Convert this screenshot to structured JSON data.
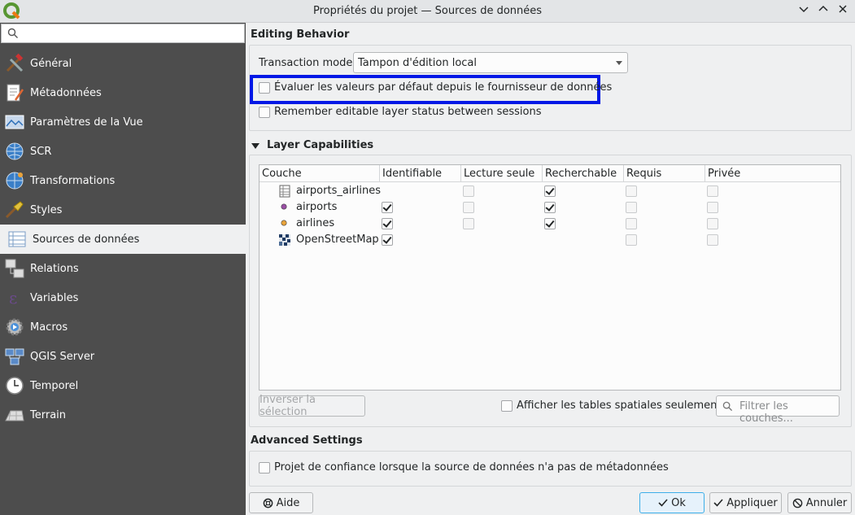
{
  "window": {
    "title": "Propriétés du projet — Sources de données"
  },
  "sidebar": {
    "search_placeholder": "",
    "items": [
      {
        "label": "Général",
        "icon": "tools-icon"
      },
      {
        "label": "Métadonnées",
        "icon": "document-edit-icon"
      },
      {
        "label": "Paramètres de la Vue",
        "icon": "map-view-icon"
      },
      {
        "label": "SCR",
        "icon": "globe-icon"
      },
      {
        "label": "Transformations",
        "icon": "globe-transform-icon"
      },
      {
        "label": "Styles",
        "icon": "paintbrush-icon"
      },
      {
        "label": "Sources de données",
        "icon": "table-list-icon"
      },
      {
        "label": "Relations",
        "icon": "relations-icon"
      },
      {
        "label": "Variables",
        "icon": "epsilon-icon"
      },
      {
        "label": "Macros",
        "icon": "gear-play-icon"
      },
      {
        "label": "QGIS Server",
        "icon": "server-icon"
      },
      {
        "label": "Temporel",
        "icon": "clock-icon"
      },
      {
        "label": "Terrain",
        "icon": "terrain-icon"
      }
    ],
    "active_index": 6
  },
  "editing": {
    "title": "Editing Behavior",
    "transaction_label": "Transaction mode",
    "transaction_value": "Tampon d'édition local",
    "evaluate_defaults_label": "Évaluer les valeurs par défaut depuis le fournisseur de données",
    "evaluate_defaults_checked": false,
    "remember_label": "Remember editable layer status between sessions",
    "remember_checked": false
  },
  "layers": {
    "title": "Layer Capabilities",
    "columns": [
      "Couche",
      "Identifiable",
      "Lecture seule",
      "Recherchable",
      "Requis",
      "Privée"
    ],
    "rows": [
      {
        "name": "airports_airlines",
        "icon": "table-icon",
        "identifiable": null,
        "readonly": false,
        "searchable": true,
        "required": false,
        "private": false
      },
      {
        "name": "airports",
        "icon": "purple-point-icon",
        "identifiable": true,
        "readonly": false,
        "searchable": true,
        "required": false,
        "private": false
      },
      {
        "name": "airlines",
        "icon": "orange-point-icon",
        "identifiable": true,
        "readonly": false,
        "searchable": true,
        "required": false,
        "private": false
      },
      {
        "name": "OpenStreetMap",
        "icon": "raster-tile-icon",
        "identifiable": true,
        "readonly": null,
        "searchable": null,
        "required": false,
        "private": false
      }
    ],
    "invert_label": "Inverser la sélection",
    "spatial_only_label": "Afficher les tables spatiales seulement",
    "filter_placeholder": "Filtrer les couches..."
  },
  "advanced": {
    "title": "Advanced Settings",
    "trust_label": "Projet de confiance lorsque la source de données n'a pas de métadonnées"
  },
  "buttons": {
    "help": "Aide",
    "ok": "Ok",
    "apply": "Appliquer",
    "cancel": "Annuler"
  },
  "colors": {
    "sidebar_bg": "#4d4d4d",
    "highlight": "#0018e6",
    "accent": "#3daee9"
  }
}
